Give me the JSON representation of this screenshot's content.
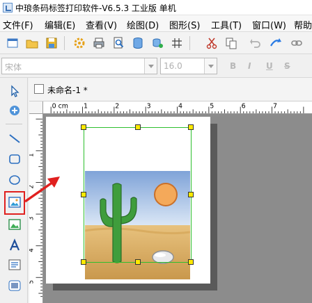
{
  "window": {
    "title": "中琅条码标签打印软件-V6.5.3 工业版 单机"
  },
  "menu": {
    "items": [
      "文件(F)",
      "编辑(E)",
      "查看(V)",
      "绘图(D)",
      "图形(S)",
      "工具(T)",
      "窗口(W)",
      "帮助"
    ]
  },
  "fontbar": {
    "font_name": "宋体",
    "font_size": "16.0",
    "bold": "B",
    "italic": "I",
    "underline": "U",
    "strike": "S"
  },
  "document": {
    "tab_label": "未命名-1 *"
  },
  "ruler": {
    "unit": "0 cm",
    "h_ticks": [
      "1",
      "2",
      "3",
      "4",
      "5",
      "6",
      "7"
    ],
    "v_ticks": [
      "1",
      "2",
      "3",
      "4",
      "5",
      "6"
    ]
  },
  "toolbar": {
    "icons": [
      "new-icon",
      "open-icon",
      "save-icon",
      "settings-icon",
      "print-icon",
      "print-preview-icon",
      "database-icon",
      "data-source-icon",
      "grid-icon",
      "cut-icon",
      "copy-icon",
      "redo-icon"
    ]
  },
  "tools": {
    "icons": [
      "select-icon",
      "pan-icon",
      "line-icon",
      "rounded-rect-icon",
      "ellipse-icon",
      "image-icon",
      "image-alt-icon",
      "text-icon",
      "rich-text-icon",
      "barcode-icon"
    ]
  },
  "colors": {
    "selection_border": "#2dbf2d",
    "handle_fill": "#ffea00",
    "callout_red": "#e0201f",
    "canvas_bg": "#8c8c8c"
  }
}
